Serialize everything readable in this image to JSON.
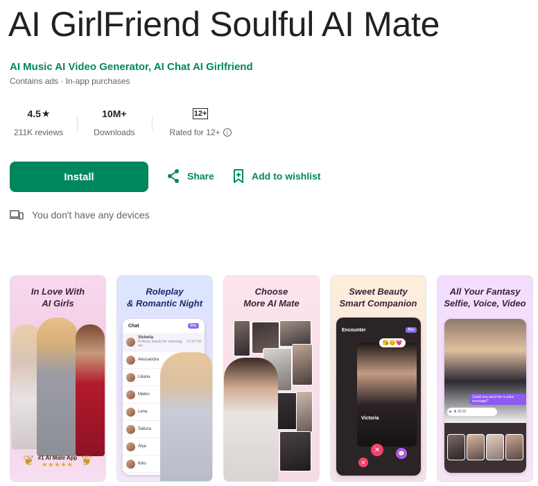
{
  "app": {
    "title": "AI GirlFriend Soulful AI Mate",
    "developer": "AI Music AI Video Generator, AI Chat AI Girlfriend",
    "meta": "Contains ads · In-app purchases"
  },
  "stats": [
    {
      "value": "4.5",
      "value_icon": "★",
      "label": "211K reviews"
    },
    {
      "value": "10M+",
      "label": "Downloads"
    },
    {
      "value": "12+",
      "label": "Rated for 12+"
    }
  ],
  "actions": {
    "install": "Install",
    "share": "Share",
    "wishlist": "Add to wishlist"
  },
  "devices": {
    "text": "You don't have any devices"
  },
  "screenshots": [
    {
      "line1": "In Love With",
      "line2": "AI Girls",
      "badge": "#1 AI Mate App",
      "badge_stars": "★★★★★"
    },
    {
      "line1": "Roleplay",
      "line2": "& Romantic Night",
      "chat": {
        "header": "Chat",
        "pro": "Pro",
        "names": [
          "Victoria",
          "Alessandra",
          "Liliana",
          "Mateo",
          "Lena",
          "Sakura",
          "Alya",
          "Kiko"
        ],
        "first_time": "17:38 PM",
        "first_msg": "Hi Anya, thanks for choosing me"
      }
    },
    {
      "line1": "Choose",
      "line2": "More AI Mate"
    },
    {
      "line1": "Sweet Beauty",
      "line2": "Smart Companion",
      "encounter": "Encounter",
      "pro": "Pro",
      "card_name": "Victoria"
    },
    {
      "line1": "All Your Fantasy",
      "line2": "Selfie, Voice, Video",
      "bubble": "Could you send me a voice message?",
      "time": "02:35"
    }
  ],
  "colors": {
    "accent": "#01875f",
    "text": "#202124",
    "secondary": "#5f6368"
  }
}
